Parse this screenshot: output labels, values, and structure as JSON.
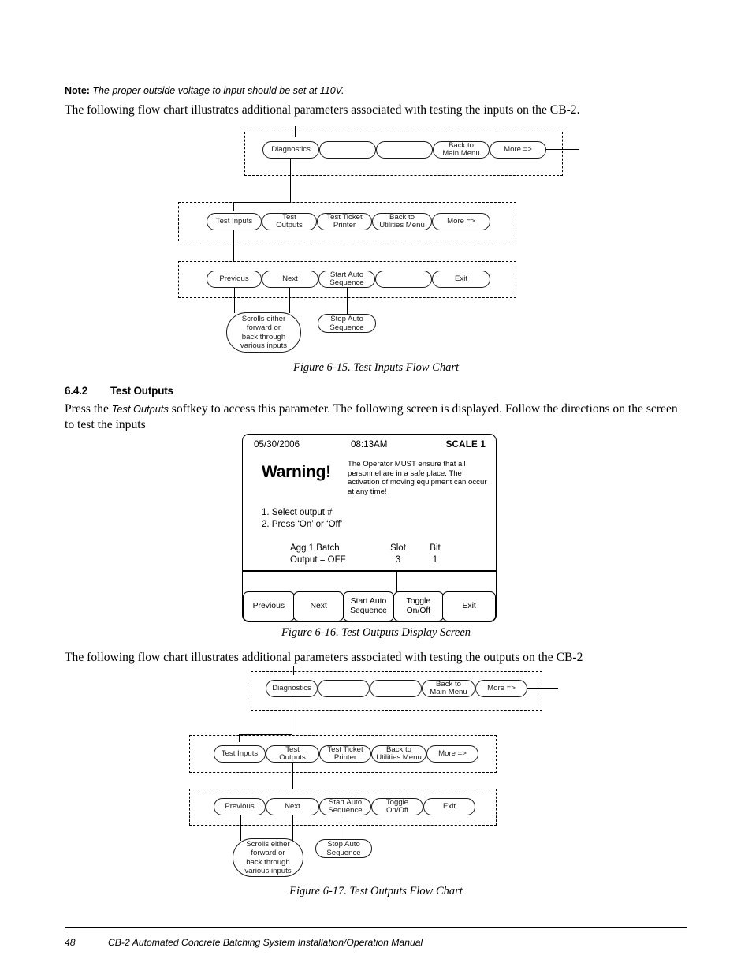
{
  "note": {
    "label": "Note:",
    "text": "The proper outside voltage to input should be set at 110V."
  },
  "intro_para_1": "The following flow chart illustrates additional parameters associated with testing the inputs on the CB-2.",
  "figure_6_15_caption": "Figure 6-15. Test Inputs Flow Chart",
  "section": {
    "number": "6.4.2",
    "title": "Test Outputs"
  },
  "body_para": {
    "before": "Press the ",
    "italic": "Test Outputs",
    "after": " softkey to access this parameter. The following screen is displayed. Follow the directions on the screen to test the inputs"
  },
  "figure_6_16_caption": "Figure 6-16. Test Outputs Display Screen",
  "intro_para_2": "The following flow chart illustrates additional parameters associated with testing the outputs on the CB-2",
  "figure_6_17_caption": "Figure 6-17. Test Outputs Flow Chart",
  "footer": {
    "page_number": "48",
    "manual_title": "CB-2 Automated Concrete Batching System Installation/Operation Manual"
  },
  "display_screen": {
    "date": "05/30/2006",
    "time": "08:13AM",
    "scale": "SCALE 1",
    "warning_title": "Warning!",
    "warning_body": "The Operator MUST ensure that all personnel are in a safe place. The activation of moving equipment can occur at any time!",
    "steps": "1. Select output #\n2. Press ‘On’ or ‘Off’",
    "data": {
      "headers": {
        "slot": "Slot",
        "bit": "Bit"
      },
      "row1_label": "Agg 1 Batch",
      "row2_label": "Output = OFF",
      "slot_value": "3",
      "bit_value": "1"
    },
    "softkeys": [
      "Previous",
      "Next",
      "Start Auto\nSequence",
      "Toggle\nOn/Off",
      "Exit"
    ]
  },
  "flow_chart_inputs": {
    "row1": [
      "Diagnostics",
      "",
      "",
      "Back to\nMain Menu",
      "More =>"
    ],
    "row2": [
      "Test Inputs",
      "Test\nOutputs",
      "Test Ticket\nPrinter",
      "Back to\nUtilities Menu",
      "More =>"
    ],
    "row3": [
      "Previous",
      "Next",
      "Start Auto\nSequence",
      "",
      "Exit"
    ],
    "note_oval": "Scrolls either\nforward or\nback through\nvarious inputs",
    "stop_oval": "Stop Auto\nSequence"
  },
  "flow_chart_outputs": {
    "row1": [
      "Diagnostics",
      "",
      "",
      "Back to\nMain Menu",
      "More =>"
    ],
    "row2": [
      "Test Inputs",
      "Test\nOutputs",
      "Test Ticket\nPrinter",
      "Back to\nUtilities Menu",
      "More =>"
    ],
    "row3": [
      "Previous",
      "Next",
      "Start Auto\nSequence",
      "Toggle\nOn/Off",
      "Exit"
    ],
    "note_oval": "Scrolls either\nforward or\nback through\nvarious inputs",
    "stop_oval": "Stop Auto\nSequence"
  }
}
